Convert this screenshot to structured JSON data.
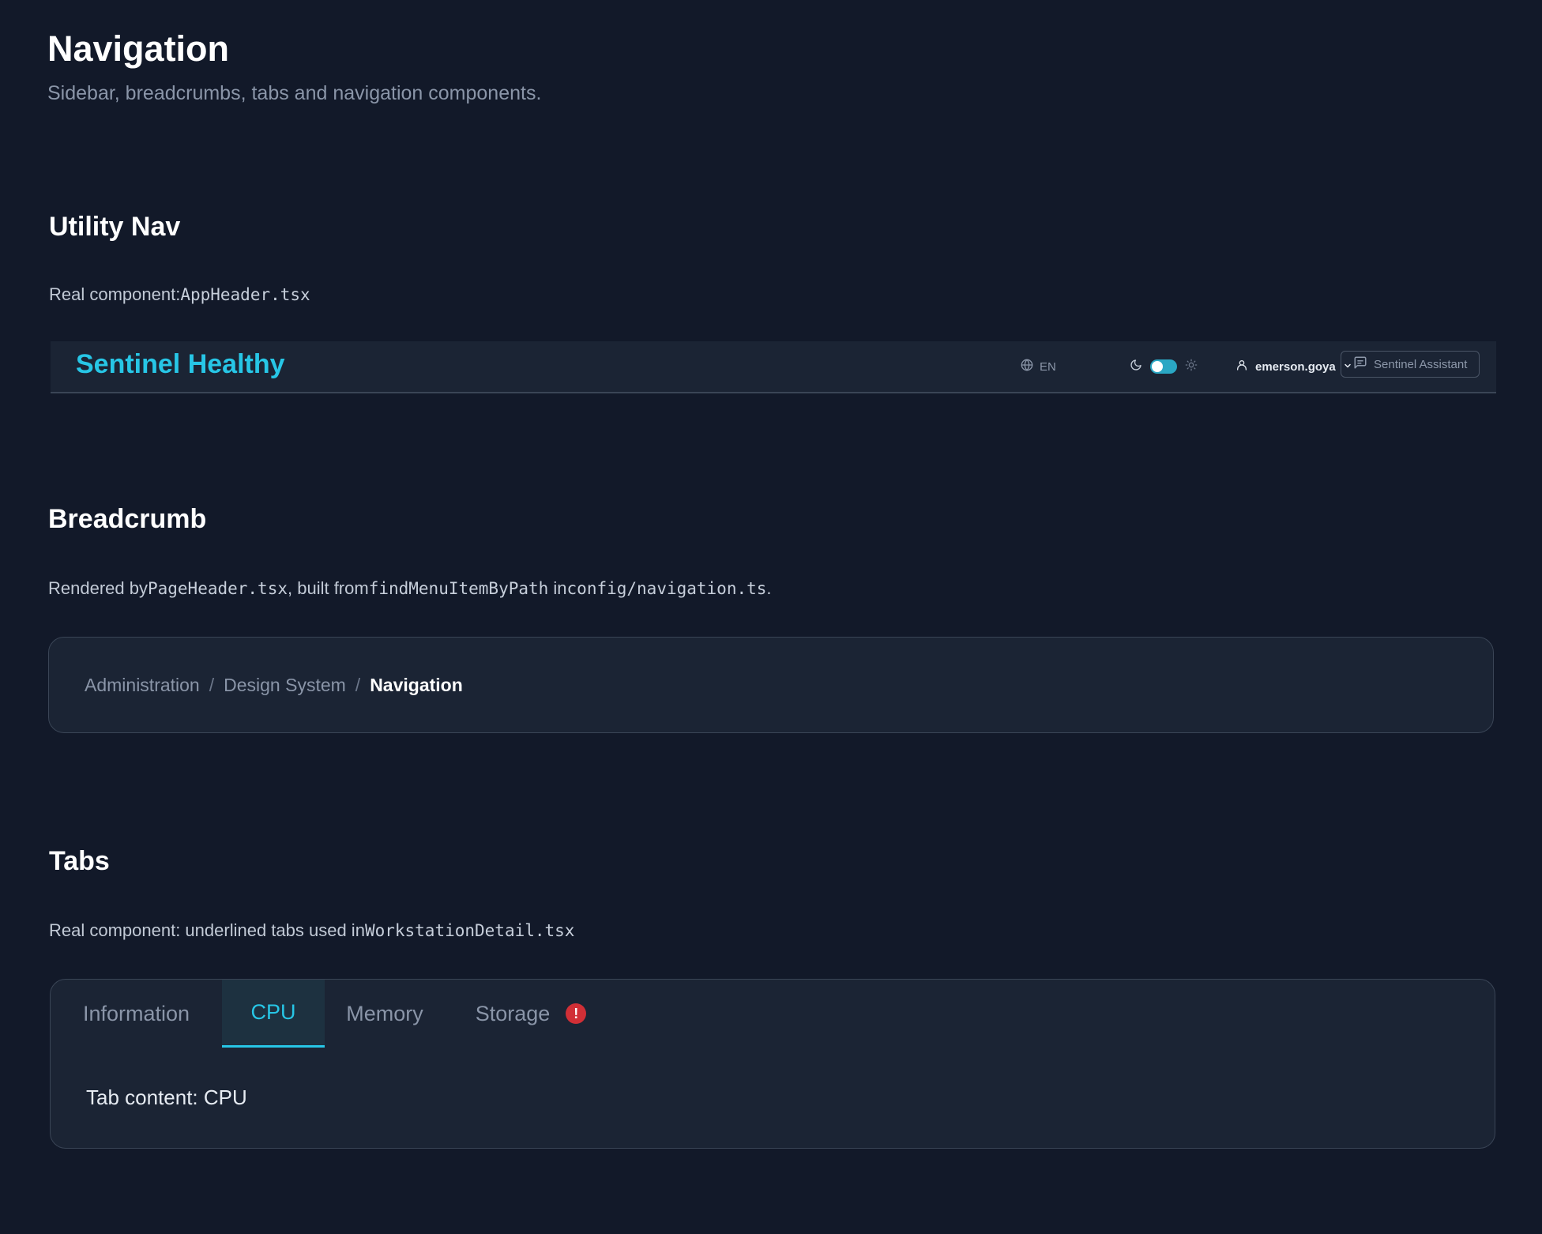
{
  "page": {
    "title": "Navigation",
    "subtitle": "Sidebar, breadcrumbs, tabs and navigation components."
  },
  "utility_nav": {
    "title": "Utility Nav",
    "desc_text": "Real component:",
    "desc_code": "AppHeader.tsx",
    "header": {
      "brand": "Sentinel Healthy",
      "language": "EN",
      "theme_toggle_on": true,
      "user": "emerson.goya",
      "assistant_label": "Sentinel Assistant",
      "icons": [
        "globe-icon",
        "moon-icon",
        "sun-icon",
        "user-icon",
        "chevron-down-icon",
        "chat-icon"
      ]
    }
  },
  "breadcrumb": {
    "title": "Breadcrumb",
    "desc": {
      "t1": "Rendered by",
      "c1": "PageHeader.tsx",
      "t2": ", built from",
      "c2": "findMenuItemByPath",
      "t3": " in",
      "c3": "config/navigation.ts",
      "t4": "."
    },
    "items": [
      "Administration",
      "Design System"
    ],
    "separator": "/",
    "current": "Navigation"
  },
  "tabs": {
    "title": "Tabs",
    "desc_text": "Real component: underlined tabs used in",
    "desc_code": "WorkstationDetail.tsx",
    "items": [
      {
        "label": "Information"
      },
      {
        "label": "CPU"
      },
      {
        "label": "Memory"
      },
      {
        "label": "Storage",
        "badge": "!"
      }
    ],
    "active_tab": "CPU",
    "content": "Tab content: CPU"
  },
  "colors": {
    "background": "#121929",
    "card": "#1b2434",
    "accent": "#27c6e6",
    "warning": "#d12f36"
  }
}
